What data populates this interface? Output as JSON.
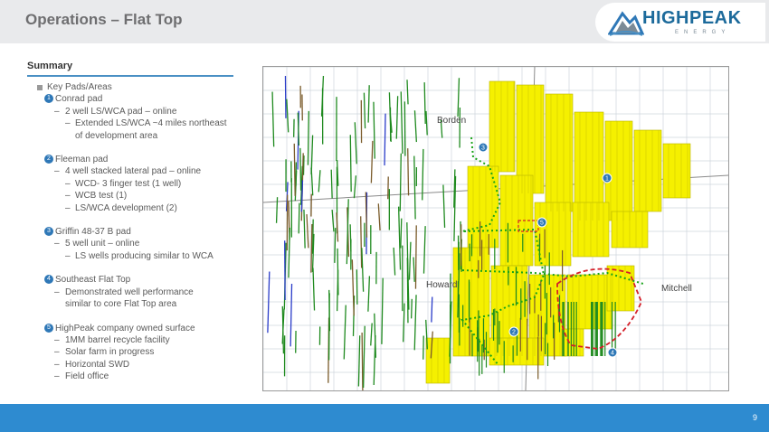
{
  "header": {
    "title": "Operations – Flat Top"
  },
  "logo": {
    "name": "HIGHPEAK",
    "sub": "ENERGY"
  },
  "summary": {
    "heading": "Summary",
    "items": [
      {
        "level": 0,
        "text": "Key Pads/Areas"
      },
      {
        "level": 1,
        "num": "1",
        "text": "Conrad pad"
      },
      {
        "level": 2,
        "text": "2 well LS/WCA pad – online"
      },
      {
        "level": 3,
        "text": "Extended  LS/WCA ~4 miles northeast"
      },
      {
        "level": 4,
        "text": "of development  area"
      },
      {
        "level": 9
      },
      {
        "level": 1,
        "num": "2",
        "text": "Fleeman pad"
      },
      {
        "level": 2,
        "text": "4 well stacked lateral pad – online"
      },
      {
        "level": 3,
        "text": "WCD- 3 finger test (1 well)"
      },
      {
        "level": 3,
        "text": "WCB test (1)"
      },
      {
        "level": 3,
        "text": "LS/WCA development  (2)"
      },
      {
        "level": 9
      },
      {
        "level": 1,
        "num": "3",
        "text": "Griffin 48-37 B pad"
      },
      {
        "level": 2,
        "text": "5 well unit – online"
      },
      {
        "level": 3,
        "text": "LS wells producing similar to WCA"
      },
      {
        "level": 9
      },
      {
        "level": 1,
        "num": "4",
        "text": "Southeast Flat Top"
      },
      {
        "level": 2,
        "text": "Demonstrated well performance"
      },
      {
        "level": 5,
        "text": "similar to core Flat Top area"
      },
      {
        "level": 9
      },
      {
        "level": 1,
        "num": "5",
        "text": "HighPeak company owned surface"
      },
      {
        "level": 2,
        "text": "1MM barrel recycle facility"
      },
      {
        "level": 2,
        "text": "Solar farm in progress"
      },
      {
        "level": 2,
        "text": "Horizontal SWD"
      },
      {
        "level": 2,
        "text": "Field office"
      }
    ]
  },
  "map": {
    "labels": {
      "borden": "Borden",
      "howard": "Howard",
      "mitchell": "Mitchell"
    },
    "markers": [
      "1",
      "2",
      "3",
      "4",
      "5"
    ],
    "colors": {
      "acreage": "#f5f000",
      "wells": "#1f8a1f",
      "pipeline": "#19a319",
      "outline": "#d4202a"
    }
  },
  "footer": {
    "page": "9"
  }
}
